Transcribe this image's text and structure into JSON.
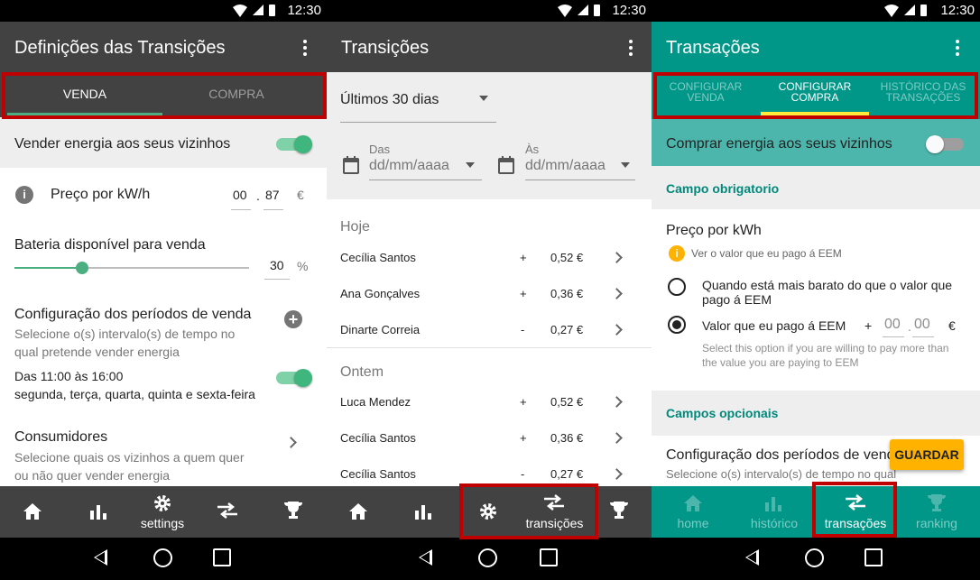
{
  "status": {
    "time": "12:30"
  },
  "screen1": {
    "title": "Definições das Transições",
    "tabs": [
      "VENDA",
      "COMPRA"
    ],
    "sell_toggle_label": "Vender energia aos seus vizinhos",
    "price_label": "Preço por kW/h",
    "price_int": "00",
    "price_sep": ".",
    "price_dec": "87",
    "currency": "€",
    "battery_label": "Bateria disponível para venda",
    "battery_value": "30",
    "battery_unit": "%",
    "battery_fraction": 0.29,
    "periods_title": "Configuração dos períodos de venda",
    "periods_desc": "Selecione o(s) intervalo(s) de tempo no qual pretende vender energia",
    "period_time": "Das 11:00 às 16:00",
    "period_days": "segunda, terça, quarta, quinta e sexta-feira",
    "consumers_title": "Consumidores",
    "consumers_desc": "Selecione quais os vizinhos a quem quer ou não quer vender energia",
    "nav": [
      "home-icon",
      "chart-icon",
      "settings",
      "swap-icon",
      "trophy-icon"
    ],
    "nav_settings_label": "settings"
  },
  "screen2": {
    "title": "Transições",
    "period_select": "Últimos 30 dias",
    "from_label": "Das",
    "from_placeholder": "dd/mm/aaaa",
    "to_label": "Às",
    "to_placeholder": "dd/mm/aaaa",
    "groups": [
      {
        "header": "Hoje",
        "rows": [
          {
            "name": "Cecília Santos",
            "sign": "+",
            "amount": "0,52 €"
          },
          {
            "name": "Ana Gonçalves",
            "sign": "+",
            "amount": "0,36 €"
          },
          {
            "name": "Dinarte Correia",
            "sign": "-",
            "amount": "0,27 €"
          }
        ]
      },
      {
        "header": "Ontem",
        "rows": [
          {
            "name": "Luca Mendez",
            "sign": "+",
            "amount": "0,52 €"
          },
          {
            "name": "Cecília Santos",
            "sign": "+",
            "amount": "0,36 €"
          },
          {
            "name": "Cecília Santos",
            "sign": "-",
            "amount": "0,27 €"
          }
        ]
      }
    ],
    "nav_transitions_label": "transições"
  },
  "screen3": {
    "title": "Transações",
    "tabs": [
      "CONFIGURAR VENDA",
      "CONFIGURAR COMPRA",
      "HISTÓRICO DAS TRANSAÇÕES"
    ],
    "buy_toggle_label": "Comprar energia aos seus vizinhos",
    "required_header": "Campo obrigatorio",
    "price_title": "Preço por kWh",
    "info_text": "Ver o valor que eu pago á EEM",
    "option1": "Quando está mais barato do que o valor que pago á EEM",
    "option2": "Valor que eu pago á EEM",
    "plus": "+",
    "val_int": "00",
    "val_sep": ".",
    "val_dec": "00",
    "currency": "€",
    "option2_hint": "Select this option if you are willing to pay more than the value you are paying to EEM",
    "optional_header": "Campos opcionais",
    "periods_title": "Configuração dos períodos de venda",
    "periods_desc": "Selecione o(s) intervalo(s) de tempo no qual",
    "save_button": "GUARDAR",
    "nav": {
      "home": "home",
      "history": "histórico",
      "transactions": "transações",
      "ranking": "ranking"
    }
  },
  "colors": {
    "dark_bar": "#424242",
    "teal": "#009688",
    "teal_light": "#4db6ac",
    "green": "#4caf82",
    "highlight": "#c00000",
    "amber": "#ffb300"
  }
}
